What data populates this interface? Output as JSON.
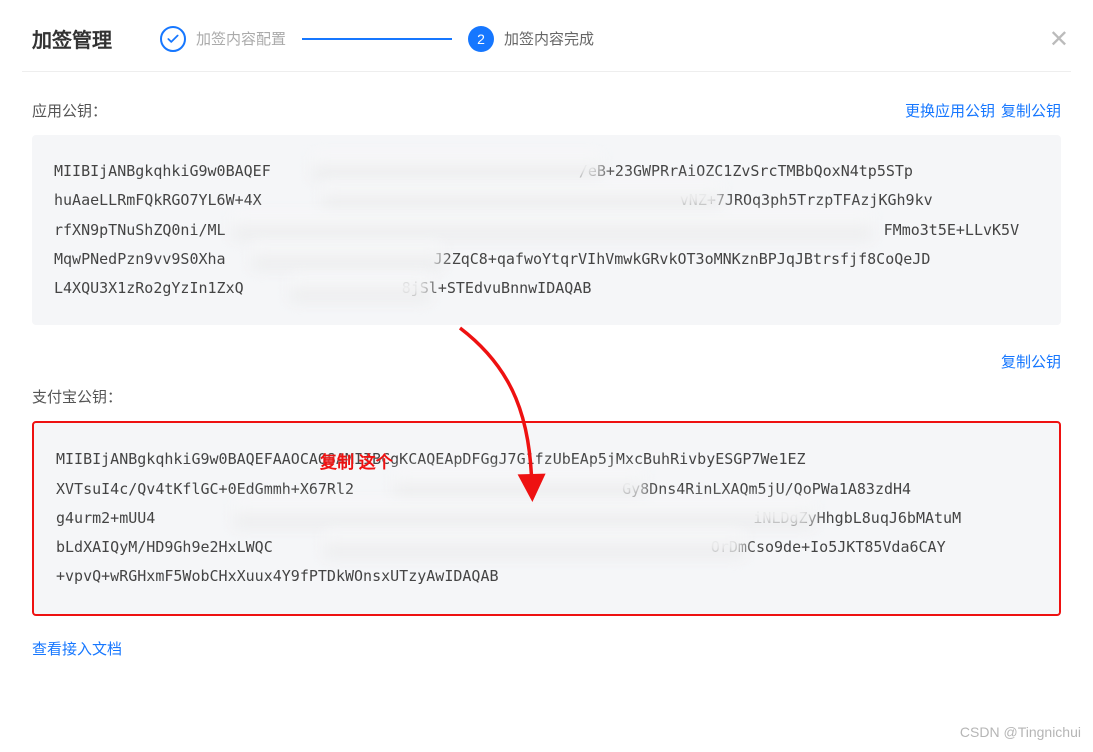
{
  "title": "加签管理",
  "steps": {
    "step1": {
      "label": "加签内容配置"
    },
    "step2": {
      "num": "2",
      "label": "加签内容完成"
    }
  },
  "close_icon": "✕",
  "appKey": {
    "label": "应用公钥：",
    "actions": {
      "change": "更换应用公钥",
      "copy": "复制公钥"
    },
    "line1_pre": "MIIBIjANBgkqhkiG9w0BAQEF",
    "line1_post": "/eB+23GWPRrAiOZC1ZvSrcTMBbQoxN4tp5STp",
    "line2_pre": "huAaeLLRmFQkRGO7YL6W+4X",
    "line2_post": "vNZ+7JROq3ph5TrzpTFAzjKGh9kv",
    "line3_pre": "rfXN9pTNuShZQ0ni/ML",
    "line3_post": "FMmo3t5E+LLvK5V",
    "line4_pre": "MqwPNedPzn9vv9S0Xha",
    "line4_post": "J2ZqC8+qafwoYtqrVIhVmwkGRvkOT3oMNKznBPJqJBtrsfjf8CoQeJD",
    "line5_pre": "L4XQU3X1zRo2gYzIn1ZxQ",
    "line5_post": "8jSl+STEdvuBnnwIDAQAB"
  },
  "copy_again": "复制公钥",
  "alipayKey": {
    "label": "支付宝公钥：",
    "line1": "MIIBIjANBgkqhkiG9w0BAQEFAAOCAQ8AMIIBCgKCAQEApDFGgJ7G1fzUbEAp5jMxcBuhRivbyESGP7We1EZ",
    "line2_pre": "XVTsuI4c/Qv4tKflGC+0EdGmmh+X67Rl2",
    "line2_post": "Gy8Dns4RinLXAQm5jU/QoPWa1A83zdH4",
    "line3_pre": "g4urm2+mUU4",
    "line3_post": "iNLDgZyHhgbL8uqJ6bMAtuM",
    "line4_pre": "bLdXAIQyM/HD9Gh9e2HxLWQC",
    "line4_post": "OrDmCso9de+Io5JKT85Vda6CAY",
    "line5": "+vpvQ+wRGHxmF5WobCHxXuux4Y9fPTDkWOnsxUTzyAwIDAQAB"
  },
  "annotation": "复制 这个",
  "footer_link": "查看接入文档",
  "watermark": "CSDN @Tingnichui"
}
